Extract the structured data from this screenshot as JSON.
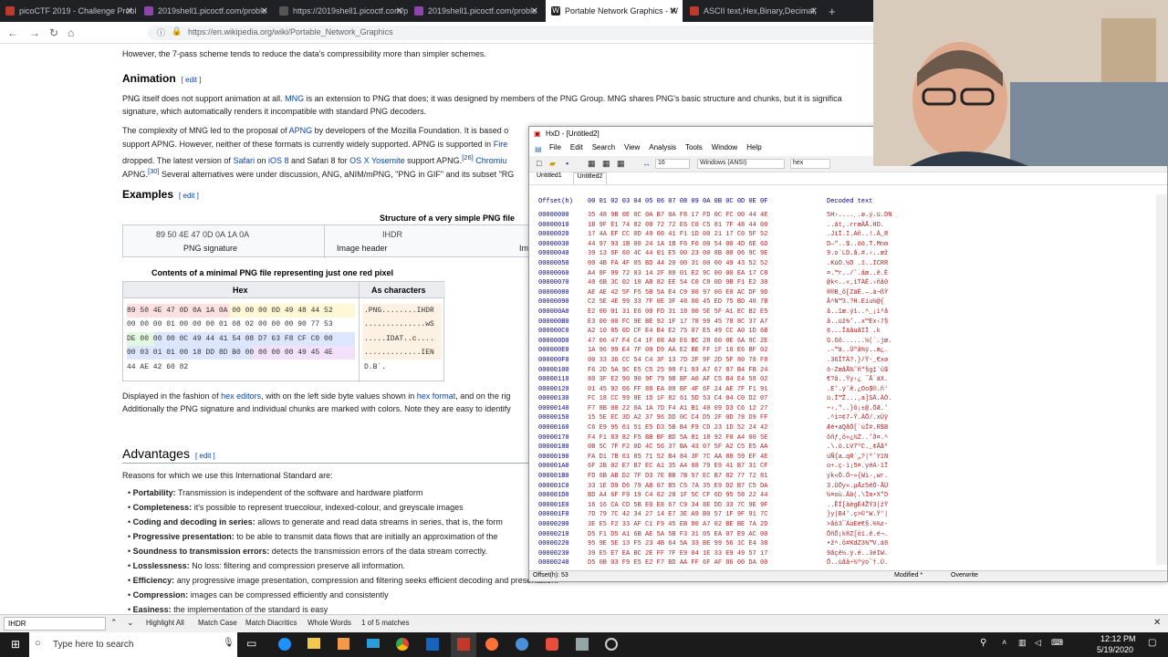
{
  "browser": {
    "tabs": [
      {
        "label": "picoCTF 2019 - Challenge Probl",
        "color": "#c0392b"
      },
      {
        "label": "2019shell1.picoctf.com/proble",
        "color": "#8e44ad"
      },
      {
        "label": "https://2019shell1.picoctf.com/p",
        "color": "#555"
      },
      {
        "label": "2019shell1.picoctf.com/proble",
        "color": "#8e44ad"
      },
      {
        "label": "Portable Network Graphics - W",
        "color": "#222"
      },
      {
        "label": "ASCII text,Hex,Binary,Decimal,",
        "color": "#c0392b"
      }
    ],
    "new_tab": "+",
    "url": "https://en.wikipedia.org/wiki/Portable_Network_Graphics"
  },
  "wiki": {
    "intro": "However, the 7-pass scheme tends to reduce the data's compressibility more than simpler schemes.",
    "animation_heading": "Animation",
    "edit": "edit",
    "anim_p1a": "PNG itself does not support animation at all.",
    "anim_p1_link": "MNG",
    "anim_p1b": "is an extension to PNG that does; it was designed by members of the PNG Group. MNG shares PNG's basic structure and chunks, but it is significa",
    "anim_p1c": "signature, which automatically renders it incompatible with standard PNG decoders.",
    "anim_p2a": "The complexity of MNG led to the proposal of",
    "anim_p2_link": "APNG",
    "anim_p2b": "by developers of the Mozilla Foundation. It is based o",
    "anim_p3a": "support APNG. However, neither of these formats is currently widely supported. APNG is supported in",
    "anim_p3_link": "Fire",
    "anim_p4a": "dropped. The latest version of",
    "anim_p4_l1": "Safari",
    "anim_p4b": "on",
    "anim_p4_l2": "iOS 8",
    "anim_p4c": "and Safari 8 for",
    "anim_p4_l3": "OS X Yosemite",
    "anim_p4d": "support APNG.",
    "anim_p4_ref": "[26]",
    "anim_p4_l4": "Chromiu",
    "anim_p5a": "APNG.",
    "anim_p5_ref": "[30]",
    "anim_p5b": "Several alternatives were under discussion, ANG, aNIM/mPNG, \"PNG in GIF\" and its subset \"RG",
    "examples_heading": "Examples",
    "struct_caption": "Structure of a very simple PNG file",
    "sig_hex": "89 50 4E 47 0D 0A 1A 0A",
    "sig_label": "PNG signature",
    "ihdr_hex": "IHDR",
    "ihdr_label": "Image header",
    "im_label": "Im",
    "contents_caption": "Contents of a minimal PNG file representing just one red pixel",
    "col_hex": "Hex",
    "col_chars": "As characters",
    "rows": [
      {
        "hex": "89 50 4E 47 0D 0A 1A 0A 00 00 00 0D 49 48 44 52",
        "chars": ".PNG........IHDR"
      },
      {
        "hex": "00 00 00 01 00 00 00 01 08 02 00 00 00 90 77 53",
        "chars": "..............wS"
      },
      {
        "hex": "DE 00 00 00 0C 49 44 41 54 08 D7 63 F8 CF C0 00",
        "chars": ".....IDAT..c...."
      },
      {
        "hex": "00 03 01 01 00 18 DD 8D B0 00 00 00 00 49 45 4E",
        "chars": ".............IEN"
      },
      {
        "hex": "44 AE 42 60 82",
        "chars": "D.B`."
      }
    ],
    "disp_a": "Displayed in the fashion of",
    "disp_l1": "hex editors",
    "disp_b": ", with on the left side byte values shown in",
    "disp_l2": "hex format",
    "disp_c": ", and on the rig",
    "disp2": "Additionally the PNG signature and individual chunks are marked with colors. Note they are easy to identify",
    "advantages_heading": "Advantages",
    "adv_intro": "Reasons for which we use this International Standard are:",
    "bullets": [
      {
        "b": "Portability:",
        "t": "Transmission is independent of the software and hardware platform"
      },
      {
        "b": "Completeness:",
        "t": "it's possible to represent truecolour, indexed-colour, and greyscale images"
      },
      {
        "b": "Coding and decoding in series:",
        "t": "allows to generate and read data streams in series, that is, the form"
      },
      {
        "b": "Progressive presentation:",
        "t": "to be able to transmit data flows that are initially an approximation of the"
      },
      {
        "b": "Soundness to transmission errors:",
        "t": "detects the transmission errors of the data stream correctly."
      },
      {
        "b": "Losslessness:",
        "t": "No loss: filtering and compression preserve all information."
      },
      {
        "b": "Efficiency:",
        "t": "any progressive image presentation, compression and filtering seeks efficient decoding and presentation."
      },
      {
        "b": "Compression:",
        "t": "images can be compressed efficiently and consistently"
      },
      {
        "b": "Easiness:",
        "t": "the implementation of the standard is easy"
      }
    ]
  },
  "hxd": {
    "title": "HxD - [Untitled2]",
    "menu": [
      "File",
      "Edit",
      "Search",
      "View",
      "Analysis",
      "Tools",
      "Window",
      "Help"
    ],
    "bytes_per_row": "16",
    "charset": "Windows (ANSI)",
    "mode": "hex",
    "doc_tabs": [
      "Untitled1",
      "Untitled2"
    ],
    "header_offset": "Offset(h)",
    "header_cols": "00 01 02 03 04 05 06 07 08 09 0A 0B 0C 0D 0E 0F",
    "header_decoded": "Decoded text",
    "offsets": [
      "00000000",
      "00000010",
      "00000020",
      "00000030",
      "00000040",
      "00000050",
      "00000060",
      "00000070",
      "00000080",
      "00000090",
      "000000A0",
      "000000B0",
      "000000C0",
      "000000D0",
      "000000E0",
      "000000F0",
      "00000100",
      "00000110",
      "00000120",
      "00000130",
      "00000140",
      "00000150",
      "00000160",
      "00000170",
      "00000180",
      "00000190",
      "000001A0",
      "000001B0",
      "000001C0",
      "000001D0",
      "000001E0",
      "000001F0",
      "00000200",
      "00000210",
      "00000220",
      "00000230",
      "00000240"
    ],
    "hexrows": [
      "35 48 9B 0E 0C 0A B7 0A F8 17 FD 0C FC 00 44 4E",
      "1B 9F E1 74 82 00 72 72 E6 C0 C5 81 7F 48 44 00",
      "17 4A EF CC 0D 49 00 41 F1 1D 00 21 17 C0 5F 52",
      "44 97 93 1B 00 24 1A 1B F6 F6 00 54 00 4D 6E 6D",
      "39 13 6F 60 4C 44 01 E5 00 23 00 8B 00 06 9C 9E",
      "00 4B FA 4F 05 BD 44 20 00 31 00 00 49 43 52 52",
      "A4 8F 99 72 03 14 2F 88 01 E2 9C 00 00 EA 17 C8",
      "40 6B 3C 02 18 AB 82 EE 54 C0 C8 0D 9B F1 E2 30",
      "AE AE 42 5F F5 5B 5A E4 C9 00 97 00 E0 AC DF 9D",
      "C2 5E 4E 99 33 7F 0E 3F 48 00 45 ED 75 BD 40 7B",
      "E2 00 01 31 E6 00 FD 31 18 00 5E 5F A1 EC B2 E5",
      "E3 00 00 FC 9E BE 92 1F 17 78 99 45 78 8C 37 A7",
      "A2 10 85 0D CF E4 B4 E2 75 07 E5 49 CC A0 1D 6B",
      "47 06 47 F4 C4 1F 08 A0 E6 BC 28 60 0E 6A 9C 2E",
      "1A 96 99 E4 7F 09 D9 AA E2 BE FF 1F 16 E6 BF 02",
      "00 33 36 CC 54 C4 3F 13 7D 2F 9F 2D 5F 80 78 F8",
      "F6 2D 5A 9C E5 C5 25 98 F1 93 A7 67 87 B4 FB 24",
      "80 3F E2 90 90 9F 79 9B BF A0 AF C5 B4 E4 58 02",
      "01 45 92 06 FF 88 EA 08 BF 4F 6F 24 AE 7F F1 91",
      "FC 18 CC 99 8E 1D 1F 82 61 5D 53 C4 04 C0 D2 07",
      "F7 8B 00 22 0A 1A 7D F4 A1 B1 40 09 D3 C6 12 27",
      "15 5E EC 3D A2 37 96 DD 0C C4 D5 2F 0D 78 D9 FF",
      "C6 E9 95 61 51 E5 D3 5B B4 F9 CD 23 1D 52 24 42",
      "F4 F1 83 82 F5 BB BF BD 5A 81 18 92 F0 A4 00 5E",
      "0B 5C 7F F2 0D 4C 56 37 BA 43 07 5F A2 C5 E5 AA",
      "FA D1 7B 61 85 71 52 B4 84 3F 7C AA 88 59 EF 4E",
      "6F 2B 02 E7 B7 EC A1 35 A4 08 79 E9 41 B7 31 CF",
      "FD 6B AB D2 7F D3 7E BB 7B 57 EC B7 82 77 72 81",
      "33 1E D9 D6 79 AB 07 B5 C5 7A 35 E9 D2 B7 C5 DA",
      "BD A4 6F F9 19 C4 62 28 1F 5C CF 6D 95 58 22 44",
      "16 16 CA CD 5B E0 E8 67 C9 34 8E DD 33 7C 9E 9F",
      "7D 79 7C 42 34 27 14 E7 3E A9 B0 57 1F 9F 91 7C",
      "3E E5 F2 33 AF C1 F9 45 EB 80 A7 02 BE BE 7A 2D",
      "D5 F1 D5 A1 6B AE 5A 5B F3 31 05 EA 07 E9 AC 00",
      "95 9E 5E 13 F5 23 4B 64 5A 33 BE 99 56 1C E4 38",
      "39 E5 E7 EA BC 2E FF 7F E9 04 1E 33 E9 49 57 17",
      "D5 0B 03 F9 E5 E2 F7 BD AA FF 6F AF 86 00 DA 00"
    ],
    "decoded": [
      "5H›....¸.ø.ý.ü.DN",
      "..át‚.rræÀÅ.HD.",
      ".JïÌ.I.Añ..!.À_R",
      "D—“..$..öö.T.Mnm",
      "9.o`LD.å.#.‹..œž",
      ".KúO.½D .1..ICRR",
      "¤.™r../ˆ.âœ..ê.È",
      "@k<..«‚îTÀÈ.›ñâ0",
      "®®B_õ[ZäÉ.—.à¬ßŸ",
      "Â^N™3.?H.Eíu½@{",
      "â..1æ.ý1..^_¡ì²å",
      "ã..üž¾’..x™Ex‹7§",
      "¢.….ÏäâuåIÌ .k",
      "G.Gô......¼(`.jœ.",
      ".–™ä..Ùªâ¾ÿ..æ¿.",
      ".36ÌTÄ?.}/Ÿ-_€xø",
      "ö-ZœåÅ%˜ñ“§g‡´û$",
      "€?â..Ÿy›¿ ¯Å´äX.",
      ".E’.ÿˆê.¿Oo$®.ñ‘",
      "ü.Ì™Ž...‚a]SÄ.ÀÒ.",
      "÷‹.\"..}ô¡±@.ÓÆ.'",
      ".^ì=¢7–Ý.ÄÕ/.xÙÿ",
      "Æé•aQåÓ[´ùÍ#.R$B",
      "ôñƒ‚õ»¿½Z..’ð¤.^",
      ".\\.ò.LV7ºC._¢Ååª",
      "úÑ{a…qR´„?|ªˆYïN",
      "o+.ç·ì¡5¤.yéA·1Ï",
      "ýk«Ò.Ó~»{Wì·‚wr.",
      "3.ÙÖy«.µÅz5éÒ·ÅÚ",
      "½¤où.Äb(.\\Ïm•X\"D",
      "..ÊÍ[àègÉ4ŽÝ3|žŸ",
      "}y|B4'.ç>©°W.Ÿ‘|",
      ">åò3¯ÁùEë€§.¾¾z-",
      "ÕñÕ¡k®Z[ó1.ê.é¬.",
      "•ž^.õ#KdZ3¾™V.ä8",
      "9åçê¼.ÿ.é..3éIW.",
      "Õ..ùåâ÷½ªÿo¯†.Ú."
    ],
    "status_offset": "Offset(h): 53",
    "status_modified": "Modified *",
    "status_overwrite": "Overwrite"
  },
  "findbar": {
    "query": "IHDR",
    "highlight_all": "Highlight All",
    "match_case": "Match Case",
    "match_diacritics": "Match Diacritics",
    "whole_words": "Whole Words",
    "result": "1 of 5 matches"
  },
  "taskbar": {
    "search_placeholder": "Type here to search",
    "time": "12:12 PM",
    "date": "5/19/2020"
  }
}
